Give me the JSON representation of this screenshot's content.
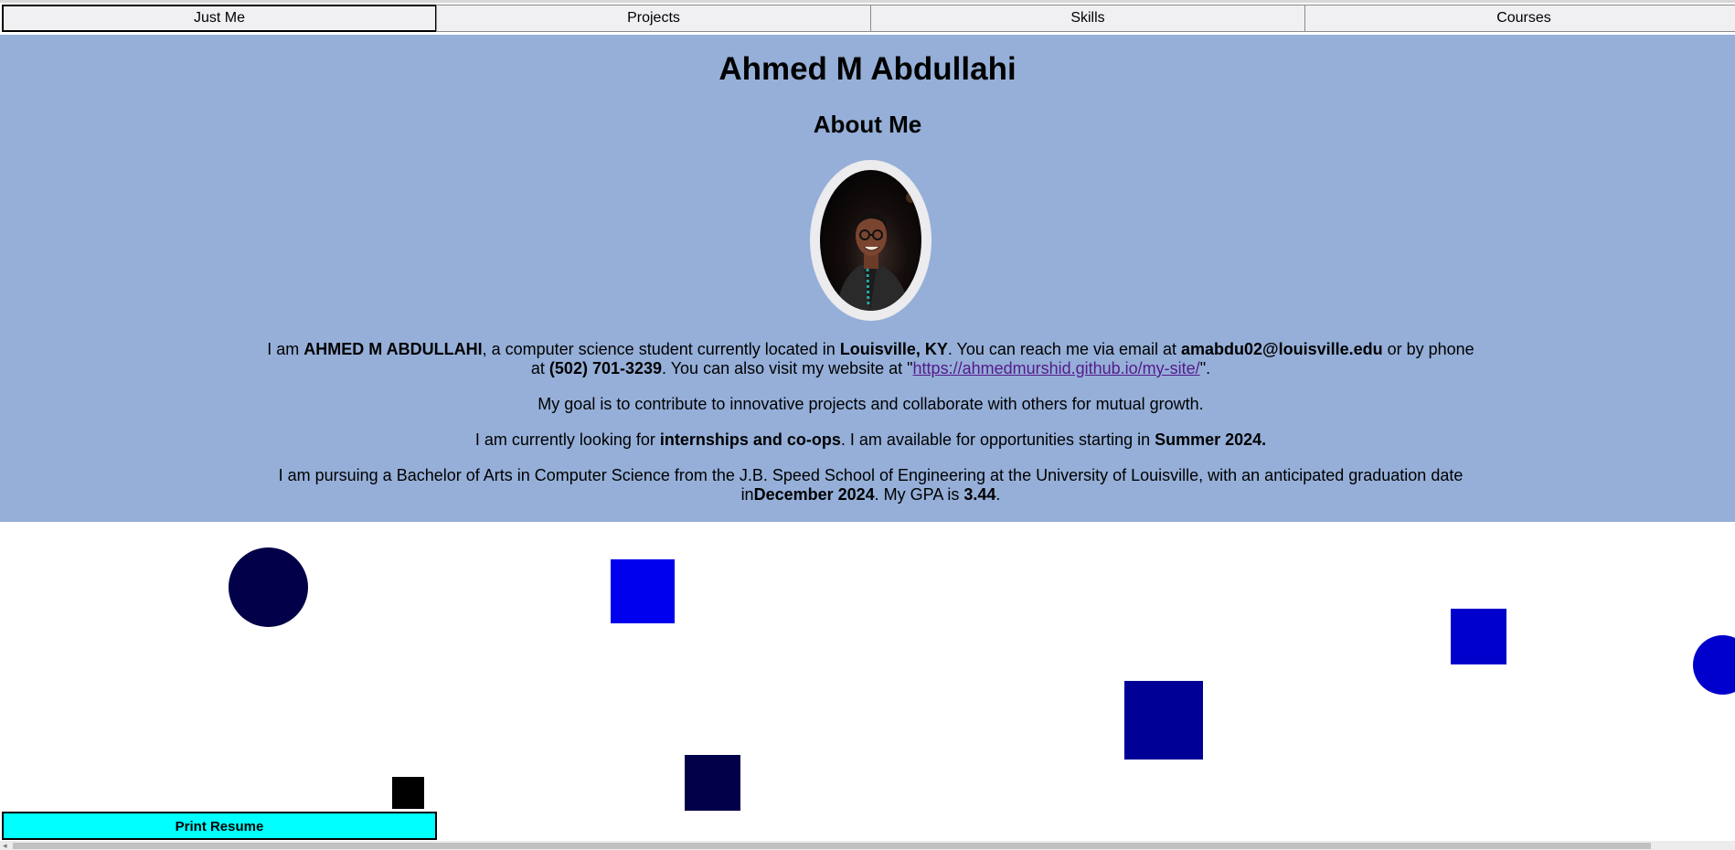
{
  "nav": {
    "tabs": [
      {
        "label": "Just Me",
        "active": true
      },
      {
        "label": "Projects",
        "active": false
      },
      {
        "label": "Skills",
        "active": false
      },
      {
        "label": "Courses",
        "active": false
      }
    ]
  },
  "about": {
    "name": "Ahmed M Abdullahi",
    "heading": "About Me",
    "intro": {
      "t1": "I am ",
      "full_name": "AHMED M ABDULLAHI",
      "t2": ", a computer science student currently located in ",
      "location": "Louisville, KY",
      "t3": ". You can reach me via email at ",
      "email": "amabdu02@louisville.edu",
      "t4": " or by phone at ",
      "phone": "(502) 701-3239",
      "t5": ". You can also visit my website at \"",
      "website": "https://ahmedmurshid.github.io/my-site/",
      "t6": "\"."
    },
    "goal": "My goal is to contribute to innovative projects and collaborate with others for mutual growth.",
    "availability": {
      "t1": "I am currently looking for ",
      "seeking": "internships and co-ops",
      "t2": ". I am available for opportunities starting in ",
      "start": "Summer 2024."
    },
    "education": {
      "t1": "I am pursuing a Bachelor of Arts in Computer Science from the J.B. Speed School of Engineering at the University of Louisville, with an anticipated graduation date in",
      "grad_date": "December 2024",
      "t2": ". My GPA is ",
      "gpa": "3.44",
      "t3": "."
    }
  },
  "actions": {
    "print_label": "Print Resume"
  },
  "colors": {
    "header_bg": "#95afd8",
    "print_button_bg": "#00ffff",
    "shape_navy": "#020048",
    "shape_blue": "#0000ee",
    "shape_darkblue": "#000096",
    "shape_mediumblue": "#0000cc"
  }
}
